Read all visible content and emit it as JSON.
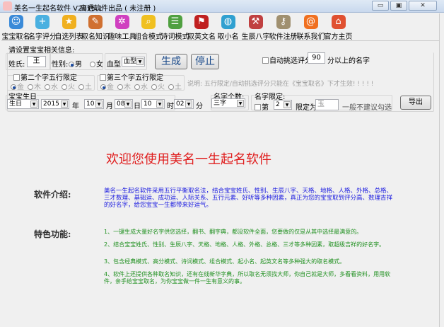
{
  "window": {
    "title": "美名一生起名软件 V2015.1",
    "subtitle": "高遇软件出品 ( 未注册 )",
    "min": "▭",
    "max": "▣",
    "close": "✕"
  },
  "toolbar": [
    {
      "label": "宝宝取名",
      "icon": "baby-users-icon",
      "color": "#3a8ad8"
    },
    {
      "label": "名字评分",
      "icon": "score-person-icon",
      "color": "#4ab0e0"
    },
    {
      "label": "自选列表",
      "icon": "star-icon",
      "color": "#f0b020"
    },
    {
      "label": "取名知识",
      "icon": "clipboard-icon",
      "color": "#d07030"
    },
    {
      "label": "趣味工具",
      "icon": "gear-icon",
      "color": "#d040c0"
    },
    {
      "label": "组合模式",
      "icon": "magnifier-icon",
      "color": "#f0c020"
    },
    {
      "label": "诗词模式",
      "icon": "reader-icon",
      "color": "#50a040"
    },
    {
      "label": "取英文名",
      "icon": "flag-icon",
      "color": "#c02020"
    },
    {
      "label": "取小名",
      "icon": "globe-person-icon",
      "color": "#30a0d0"
    },
    {
      "label": "生辰八字",
      "icon": "tools-icon",
      "color": "#c04040"
    },
    {
      "label": "软件注册",
      "icon": "keys-icon",
      "color": "#a09070"
    },
    {
      "label": "联系我们",
      "icon": "contact-icon",
      "color": "#f07020"
    },
    {
      "label": "官方主页",
      "icon": "home-icon",
      "color": "#e05030"
    }
  ],
  "form": {
    "section_title": "请设置宝宝相关信息:",
    "surname_label": "姓氏:",
    "surname_value": "王",
    "gender_label": "性别:",
    "gender_male": "男",
    "gender_female": "女",
    "blood_label": "血型:",
    "blood_value": "血型",
    "generate": "生成",
    "stop": "停止",
    "auto_label": "自动挑选评分为:",
    "auto_value": "90",
    "auto_suffix": "分以上的名字",
    "second_group": "第二个字五行限定",
    "third_group": "第三个字五行限定",
    "elements": [
      "金",
      "木",
      "水",
      "火",
      "土"
    ],
    "note": "说明: 五行限定/自动挑选评分只能在《宝宝取名》下才生效! ! ! ! !",
    "birthday_title": "宝宝生日",
    "calendar": "生日",
    "year": "2015",
    "year_unit": "年",
    "month": "10",
    "month_unit": "月",
    "day": "08",
    "day_unit": "日",
    "hour": "10",
    "hour_unit": "时",
    "minute": "02",
    "minute_unit": "分",
    "count_title": "名字个数:",
    "count_value": "三字",
    "limit_title": "名字限定:",
    "limit_check": "第",
    "limit_pos": "2",
    "limit_as": "限定为",
    "limit_char": "玉",
    "limit_hint": "一般不建议勾选",
    "export": "导出"
  },
  "content": {
    "welcome": "欢迎您使用美名一生起名软件",
    "intro_title": "软件介绍:",
    "intro": "美名一生起名软件采用五行平衡取名法，结合宝宝姓氏、性别、生辰八字、天格、地格、人格、外格、总格、三才数理、基础运、成功运、人际关系、五行元素、好听等多种因素，真正为您的宝宝取到评分高、数理吉祥的好名字，给您宝宝一生都带来好运气。",
    "features_title": "特色功能:",
    "features": [
      "1、一键生成大量好名字供您选择，翻书、翻字典，都没软件全面，您要做的仅是从其中选择最满意的。",
      "2、结合宝宝姓氏、性别、生辰八字、天格、地格、人格、外格、总格、三才等多种因素，取超级吉祥的好名字。",
      "3、包含经典模式、高分模式、诗词模式、组合模式、起小名、起英文名等多种强大的取名模式。",
      "4、软件上还提供各种取名知识，还有在线新华字典，所以取名无须找大师，你自己就是大师，多看看资料，用用软件，亲手给宝宝取名，为你宝宝做一件一生有意义的事。"
    ]
  }
}
